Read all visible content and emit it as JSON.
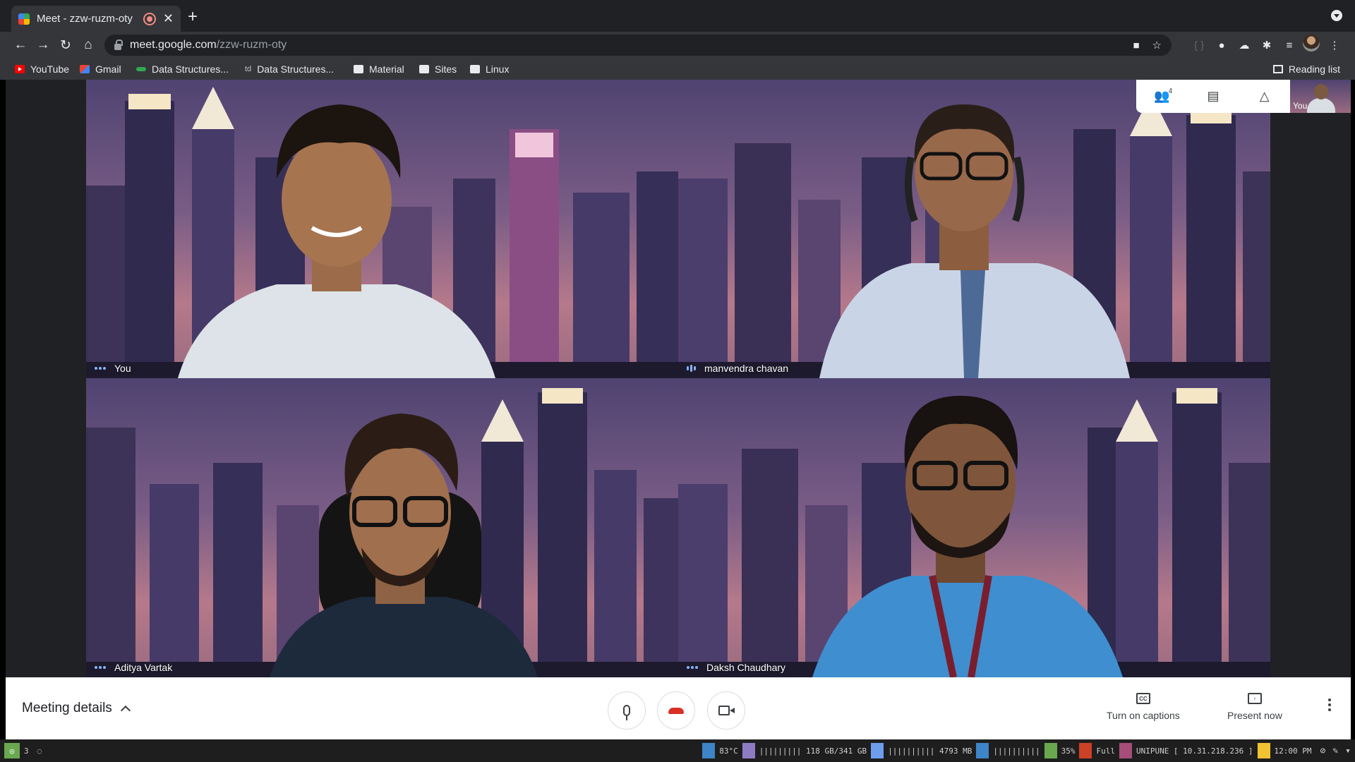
{
  "browser": {
    "tab_title": "Meet - zzw-ruzm-oty",
    "url_host": "meet.google.com",
    "url_path": "/zzw-ruzm-oty",
    "bookmarks": [
      {
        "label": "YouTube",
        "icon": "youtube-icon"
      },
      {
        "label": "Gmail",
        "icon": "gmail-icon"
      },
      {
        "label": "Data Structures...",
        "icon": "site-icon"
      },
      {
        "label": "Data Structures...",
        "icon": "td-icon"
      },
      {
        "label": "Material",
        "icon": "folder-icon"
      },
      {
        "label": "Sites",
        "icon": "folder-icon"
      },
      {
        "label": "Linux",
        "icon": "folder-icon"
      }
    ],
    "reading_list": "Reading list",
    "td_badge": "td"
  },
  "meet": {
    "participants_count": "4",
    "self_preview_label": "You",
    "tiles": [
      {
        "name": "You"
      },
      {
        "name": "manvendra chavan"
      },
      {
        "name": "Aditya Vartak"
      },
      {
        "name": "Daksh Chaudhary"
      }
    ],
    "meeting_details": "Meeting details",
    "captions_label": "Turn on captions",
    "captions_icon_text": "CC",
    "present_label": "Present now"
  },
  "statusbar": {
    "workspace": "3",
    "temp": "83°C",
    "disk": "||||||||| 118 GB/341 GB",
    "memory": "|||||||||| 4793 MB",
    "volume": "||||||||||",
    "brightness": "35%",
    "battery": "Full",
    "wifi": "UNIPUNE [ 10.31.218.236 ]",
    "clock": "12:00 PM"
  },
  "colors": {
    "meet_blue": "#8ab4f8",
    "hangup_red": "#d93025",
    "chrome_dark": "#202124"
  }
}
